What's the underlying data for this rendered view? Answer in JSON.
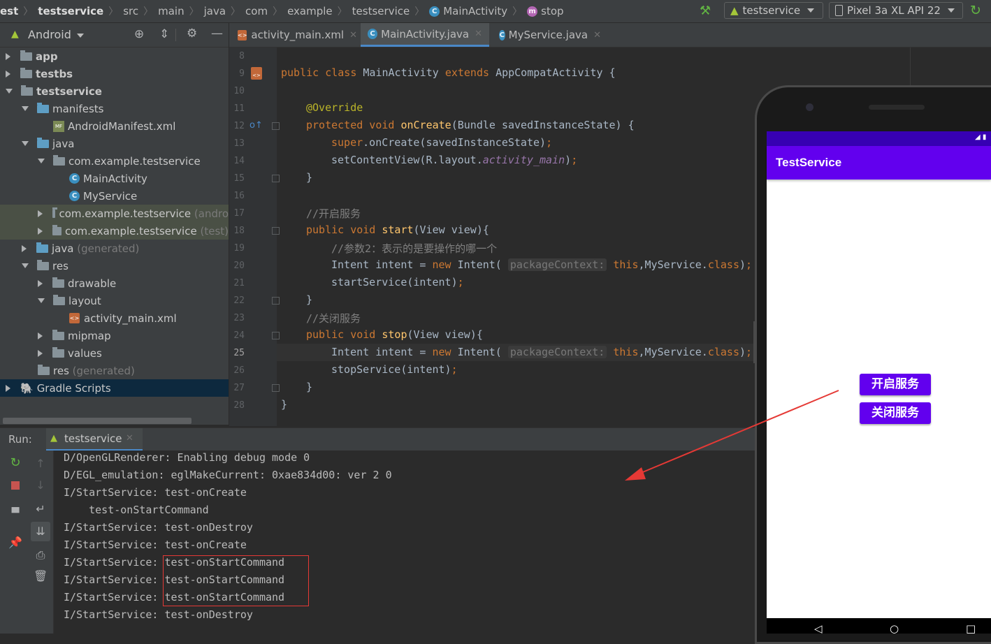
{
  "breadcrumbs": [
    "est",
    "testservice",
    "src",
    "main",
    "java",
    "com",
    "example",
    "testservice",
    "MainActivity",
    "stop"
  ],
  "toolbar": {
    "config": "testservice",
    "device": "Pixel 3a XL API 22"
  },
  "project": {
    "view": "Android",
    "tree": [
      {
        "label": "app",
        "bold": true
      },
      {
        "label": "testbs",
        "bold": true
      },
      {
        "label": "testservice",
        "bold": true
      },
      {
        "label": "manifests"
      },
      {
        "label": "AndroidManifest.xml"
      },
      {
        "label": "java"
      },
      {
        "label": "com.example.testservice"
      },
      {
        "label": "MainActivity"
      },
      {
        "label": "MyService"
      },
      {
        "label": "com.example.testservice",
        "suffix": "(andro"
      },
      {
        "label": "com.example.testservice",
        "suffix": "(test)"
      },
      {
        "label": "java",
        "suffix": "(generated)"
      },
      {
        "label": "res"
      },
      {
        "label": "drawable"
      },
      {
        "label": "layout"
      },
      {
        "label": "activity_main.xml"
      },
      {
        "label": "mipmap"
      },
      {
        "label": "values"
      },
      {
        "label": "res",
        "suffix": "(generated)"
      },
      {
        "label": "Gradle Scripts"
      }
    ]
  },
  "editor": {
    "tabs": [
      "activity_main.xml",
      "MainActivity.java",
      "MyService.java"
    ],
    "active_tab": 1,
    "line_numbers": [
      "8",
      "9",
      "10",
      "11",
      "12",
      "13",
      "14",
      "15",
      "16",
      "17",
      "18",
      "19",
      "20",
      "21",
      "22",
      "23",
      "24",
      "25",
      "26",
      "27",
      "28"
    ],
    "current_line": "25",
    "code": {
      "l9_a": "public class ",
      "l9_b": "MainActivity ",
      "l9_c": "extends ",
      "l9_d": "AppCompatActivity {",
      "l11": "@Override",
      "l12_a": "protected void ",
      "l12_b": "onCreate",
      "l12_c": "(Bundle savedInstanceState) {",
      "l13_a": "super",
      "l13_b": ".onCreate(savedInstanceState)",
      "l13_c": ";",
      "l14_a": "setContentView(R.layout.",
      "l14_b": "activity_main",
      "l14_c": ")",
      "l14_d": ";",
      "l15": "}",
      "l17": "//开启服务",
      "l18_a": "public void ",
      "l18_b": "start",
      "l18_c": "(View view){",
      "l19": "//参数2：表示的是要操作的哪一个",
      "l20_a": "Intent intent = ",
      "l20_b": "new ",
      "l20_c": "Intent(",
      "l20_hint": "packageContext:",
      "l20_d": "this",
      "l20_e": ",MyService.",
      "l20_f": "class",
      "l20_g": ")",
      "l20_h": ";",
      "l21_a": "startService(intent)",
      "l21_b": ";",
      "l22": "}",
      "l23": "//关闭服务",
      "l24_a": "public void ",
      "l24_b": "stop",
      "l24_c": "(View view){",
      "l25_a": "Intent intent = ",
      "l25_b": "new ",
      "l25_c": "Intent(",
      "l25_hint": "packageContext:",
      "l25_d": "this",
      "l25_e": ",MyService.",
      "l25_f": "class",
      "l25_g": ")",
      "l25_h": ";",
      "l26_a": "stopService(intent)",
      "l26_b": ";",
      "l27": "}",
      "l28": "}"
    }
  },
  "run": {
    "label": "Run:",
    "tab": "testservice",
    "lines": [
      "D/OpenGLRenderer: Enabling debug mode 0",
      "D/EGL_emulation: eglMakeCurrent: 0xae834d00: ver 2 0",
      "I/StartService: test-onCreate",
      "    test-onStartCommand",
      "I/StartService: test-onDestroy",
      "I/StartService: test-onCreate",
      "I/StartService: test-onStartCommand",
      "I/StartService: test-onStartCommand",
      "I/StartService: test-onStartCommand",
      "I/StartService: test-onDestroy"
    ]
  },
  "phone": {
    "app_title": "TestService",
    "start_button": "开启服务",
    "stop_button": "关闭服务"
  },
  "colors": {
    "accent": "#6200ee",
    "status_bar": "#3700b3",
    "annotation": "#e53935"
  }
}
